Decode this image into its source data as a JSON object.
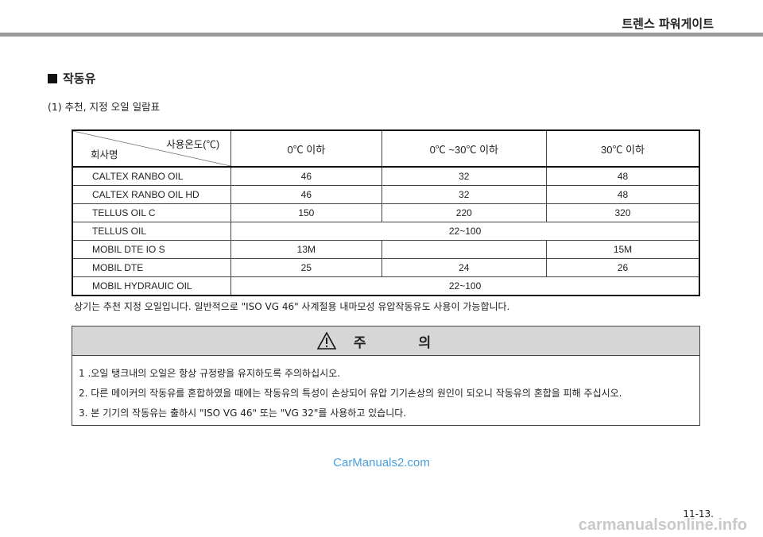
{
  "header": {
    "title": "트렌스 파워게이트"
  },
  "section": {
    "title": "작동유",
    "subtitle": "(1) 추천, 지정 오일 일람표"
  },
  "table": {
    "corner_top": "사용온도(℃)",
    "corner_bottom": "회사명",
    "columns": [
      "0℃ 이하",
      "0℃ ~30℃ 이하",
      "30℃ 이하"
    ],
    "rows": [
      {
        "name": "CALTEX RANBO OIL",
        "c1": "46",
        "c2": "32",
        "c3": "48"
      },
      {
        "name": "CALTEX RANBO OIL HD",
        "c1": "46",
        "c2": "32",
        "c3": "48"
      },
      {
        "name": "TELLUS OIL C",
        "c1": "150",
        "c2": "220",
        "c3": "320"
      },
      {
        "name": "TELLUS OIL",
        "span": "22~100"
      },
      {
        "name": "MOBIL DTE IO S",
        "c1": "13M",
        "c2": "",
        "c3": "15M"
      },
      {
        "name": "MOBIL DTE",
        "c1": "25",
        "c2": "24",
        "c3": "26"
      },
      {
        "name": "MOBIL HYDRAUIC OIL",
        "span": "22~100"
      }
    ]
  },
  "note": "상기는 추천 지정 오일입니다. 일반적으로 \"ISO VG 46\" 사계절용 내마모성 유압작동유도 사용이 가능합니다.",
  "caution": {
    "title": "주 의",
    "icon": "warning-triangle-icon",
    "items": [
      "1 .오일 탱크내의 오일은 항상 규정량을 유지하도록 주의하십시오.",
      "2. 다른 메이커의 작동유를 혼합하였을 때에는 작동유의 특성이 손상되어 유압 기기손상의 원인이 되오니 작동유의 혼합을 피해 주십시오.",
      "3. 본 기기의 작동유는 출하시 \"ISO VG 46\" 또는 \"VG 32\"를 사용하고 있습니다."
    ]
  },
  "watermark": "CarManuals2.com",
  "page_number": "11-13.",
  "footer_watermark": "carmanualsonline.info",
  "colors": {
    "header_rule": "#9a9a9a",
    "caution_header": "#d6d6d6",
    "watermark": "#4aa0dc"
  }
}
